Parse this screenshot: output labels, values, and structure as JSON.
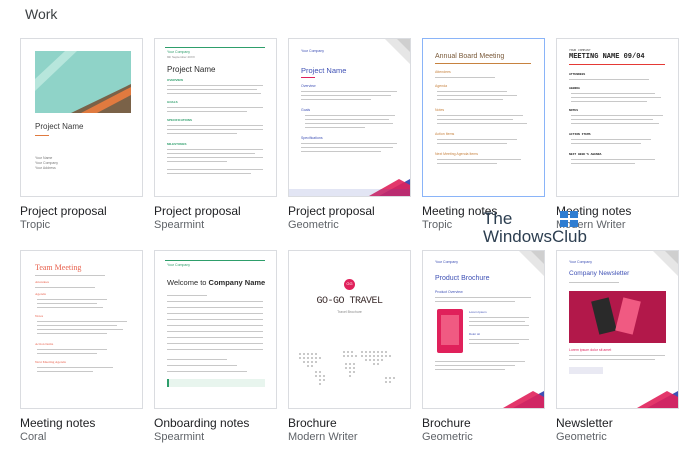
{
  "section": {
    "title": "Work"
  },
  "templates": [
    {
      "name": "Project proposal",
      "style": "Tropic",
      "preview": {
        "heading": "Project Name",
        "lines": [
          "Your Name",
          "Your Company",
          "Your Address"
        ]
      }
    },
    {
      "name": "Project proposal",
      "style": "Spearmint",
      "preview": {
        "company": "Your Company",
        "date": "9th September 20XX",
        "heading": "Project Name",
        "sections": [
          "OVERVIEW",
          "GOALS",
          "SPECIFICATIONS",
          "MILESTONES"
        ]
      }
    },
    {
      "name": "Project proposal",
      "style": "Geometric",
      "preview": {
        "company": "Your Company",
        "heading": "Project Name",
        "sections": [
          "Overview",
          "Goals",
          "Specifications"
        ]
      }
    },
    {
      "name": "Meeting notes",
      "style": "Tropic",
      "preview": {
        "heading": "Annual Board Meeting",
        "sections": [
          "Attendees",
          "Agenda",
          "Notes",
          "Action Items",
          "Next Meeting Agenda Items"
        ]
      }
    },
    {
      "name": "Meeting notes",
      "style": "Modern Writer",
      "preview": {
        "label": "YOUR COMPANY",
        "heading": "MEETING NAME 09/04",
        "sections": [
          "ATTENDEES",
          "AGENDA",
          "NOTES",
          "ACTION ITEMS",
          "NEXT WEEK'S AGENDA"
        ]
      }
    },
    {
      "name": "Meeting notes",
      "style": "Coral",
      "preview": {
        "heading": "Team Meeting",
        "sections": [
          "Attendees",
          "Agenda",
          "Notes",
          "Action Items",
          "Next Meeting Agenda"
        ]
      }
    },
    {
      "name": "Onboarding notes",
      "style": "Spearmint",
      "preview": {
        "company": "Your Company",
        "heading": "Welcome to ",
        "heading_bold": "Company Name"
      }
    },
    {
      "name": "Brochure",
      "style": "Modern Writer",
      "preview": {
        "logo": "GG",
        "heading": "GO-GO TRAVEL",
        "tagline": "Travel Brochure"
      }
    },
    {
      "name": "Brochure",
      "style": "Geometric",
      "preview": {
        "company": "Your Company",
        "heading": "Product Brochure",
        "sections": [
          "Product Overview",
          "Lorem Ipsum",
          "Dolor sit"
        ]
      }
    },
    {
      "name": "Newsletter",
      "style": "Geometric",
      "preview": {
        "company": "Your Company",
        "heading": "Company Newsletter",
        "caption": "Lorem ipsum dolor sit amet"
      }
    }
  ],
  "watermark": {
    "line1": "The",
    "line2": "WindowsClub"
  },
  "colors": {
    "tropic_teal": "#8fd3c8",
    "tropic_brown": "#7a6248",
    "tropic_orange": "#e07a3f",
    "spearmint": "#2e9e6b",
    "geometric_blue": "#3f51b5",
    "geometric_pink": "#e0215b",
    "coral": "#e8604c",
    "annual_orange": "#c7823f",
    "selected_border": "#8ab4f8"
  }
}
